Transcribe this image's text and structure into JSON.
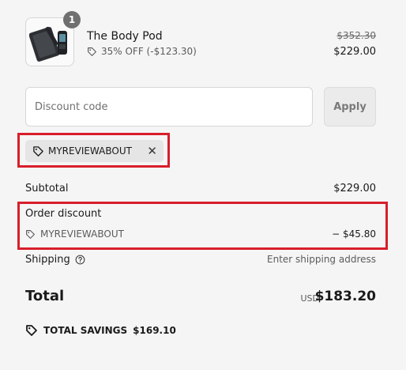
{
  "product": {
    "name": "The Body Pod",
    "quantity": "1",
    "discount_label": "35% OFF (-$123.30)",
    "original_price": "$352.30",
    "final_price": "$229.00"
  },
  "discount_field": {
    "placeholder": "Discount code",
    "value": "",
    "apply_label": "Apply"
  },
  "applied_code": {
    "code": "MYREVIEWABOUT",
    "remove_glyph": "✕"
  },
  "summary": {
    "subtotal_label": "Subtotal",
    "subtotal_value": "$229.00",
    "order_discount_label": "Order discount",
    "order_discount_code": "MYREVIEWABOUT",
    "order_discount_value": "− $45.80",
    "shipping_label": "Shipping",
    "shipping_value": "Enter shipping address",
    "total_label": "Total",
    "total_currency": "USD",
    "total_value": "$183.20",
    "savings_label": "TOTAL SAVINGS",
    "savings_value": "$169.10"
  },
  "colors": {
    "background": "#f5f5f5",
    "highlight": "#d81e2a",
    "chip": "#e5e5e5",
    "badge": "#707070"
  },
  "icons": {
    "tag": "tag-icon",
    "remove": "close-icon",
    "help": "help-circle-icon",
    "savings": "savings-tag-icon"
  }
}
